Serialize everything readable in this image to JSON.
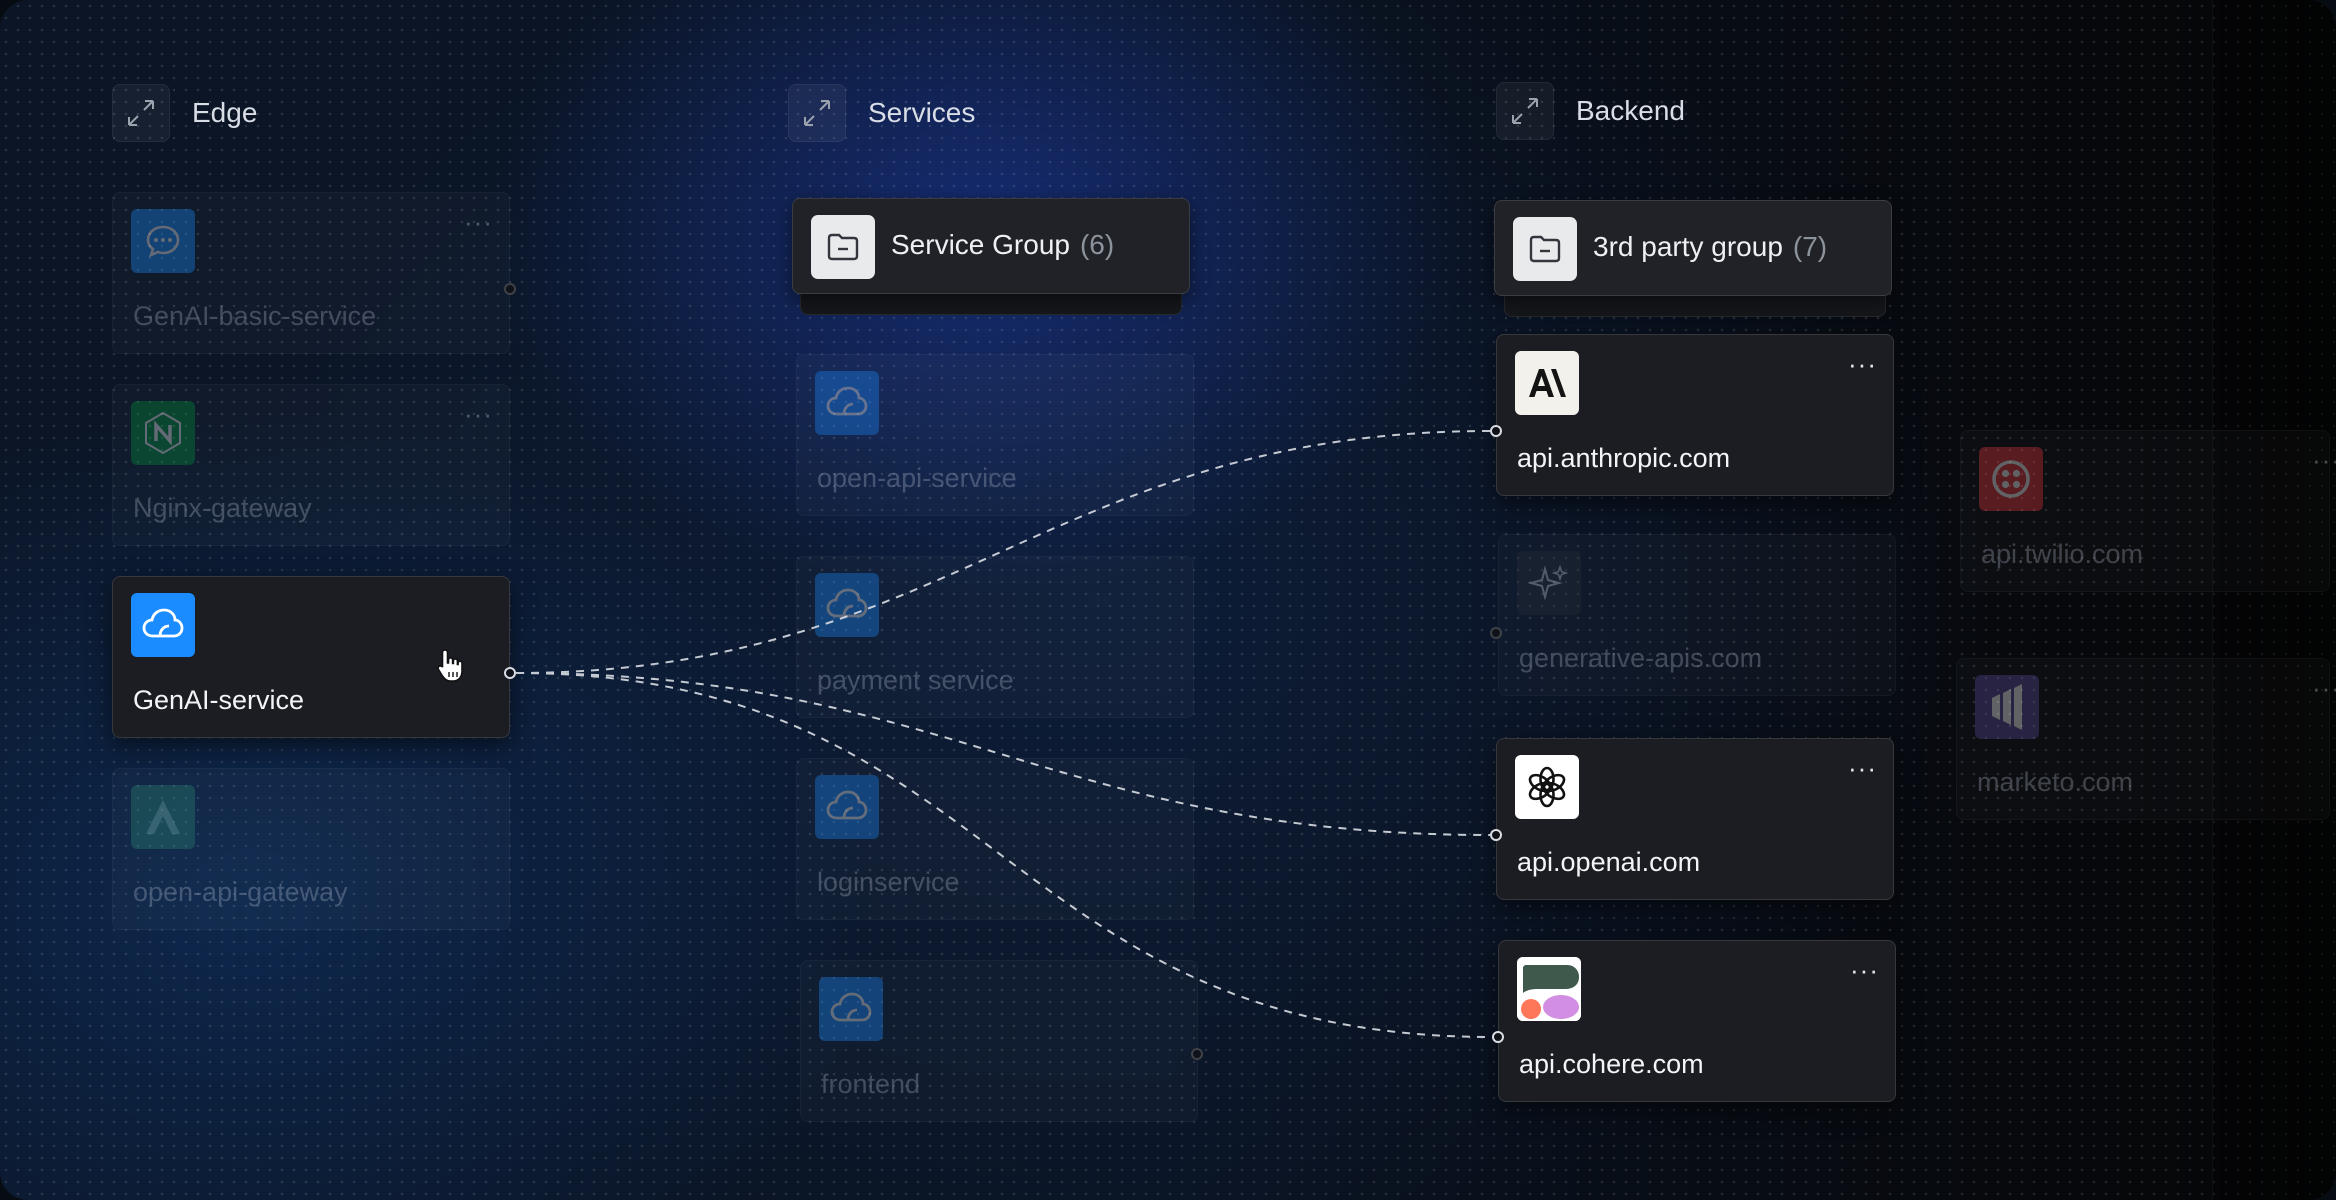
{
  "columns": [
    {
      "title": "Edge",
      "icon": "expand-icon"
    },
    {
      "title": "Services",
      "icon": "expand-icon"
    },
    {
      "title": "Backend",
      "icon": "expand-icon"
    }
  ],
  "edge": {
    "items": [
      {
        "label": "GenAI-basic-service",
        "icon": "chat-icon",
        "state": "dimmed",
        "menu": "···"
      },
      {
        "label": "Nginx-gateway",
        "icon": "nginx-icon",
        "state": "dimmed",
        "menu": "···"
      },
      {
        "label": "GenAI-service",
        "icon": "cloud-icon",
        "state": "selected"
      },
      {
        "label": "open-api-gateway",
        "icon": "gateway-icon",
        "state": "dimmed"
      }
    ]
  },
  "services": {
    "group": {
      "label": "Service Group",
      "count": "(6)",
      "icon": "folder-icon"
    },
    "items": [
      {
        "label": "open-api-service",
        "icon": "cloud-icon",
        "state": "dimmed"
      },
      {
        "label": "payment service",
        "icon": "cloud-icon",
        "state": "dimmed"
      },
      {
        "label": "loginservice",
        "icon": "cloud-icon",
        "state": "dimmed"
      },
      {
        "label": "frontend",
        "icon": "cloud-icon",
        "state": "dimmed"
      }
    ]
  },
  "backend": {
    "group": {
      "label": "3rd party group",
      "count": "(7)",
      "icon": "folder-icon"
    },
    "items": [
      {
        "label": "api.anthropic.com",
        "icon": "anthropic-logo-icon",
        "state": "connected",
        "menu": "···"
      },
      {
        "label": "generative-apis.com",
        "icon": "sparkle-icon",
        "state": "dimmed"
      },
      {
        "label": "api.openai.com",
        "icon": "openai-logo-icon",
        "state": "connected",
        "menu": "···"
      },
      {
        "label": "api.cohere.com",
        "icon": "cohere-logo-icon",
        "state": "connected",
        "menu": "···"
      }
    ]
  },
  "external": {
    "items": [
      {
        "label": "api.twilio.com",
        "icon": "twilio-logo-icon",
        "state": "dimmed",
        "menu": "···"
      },
      {
        "label": "marketo.com",
        "icon": "marketo-logo-icon",
        "state": "dimmed",
        "menu": "···"
      }
    ]
  },
  "colors": {
    "accent_blue": "#1a8cff",
    "card_bg": "#1b1d22",
    "link_line": "#d9dde3",
    "twilio_red": "#e8363d",
    "marketo_purple": "#5c4c9f"
  }
}
